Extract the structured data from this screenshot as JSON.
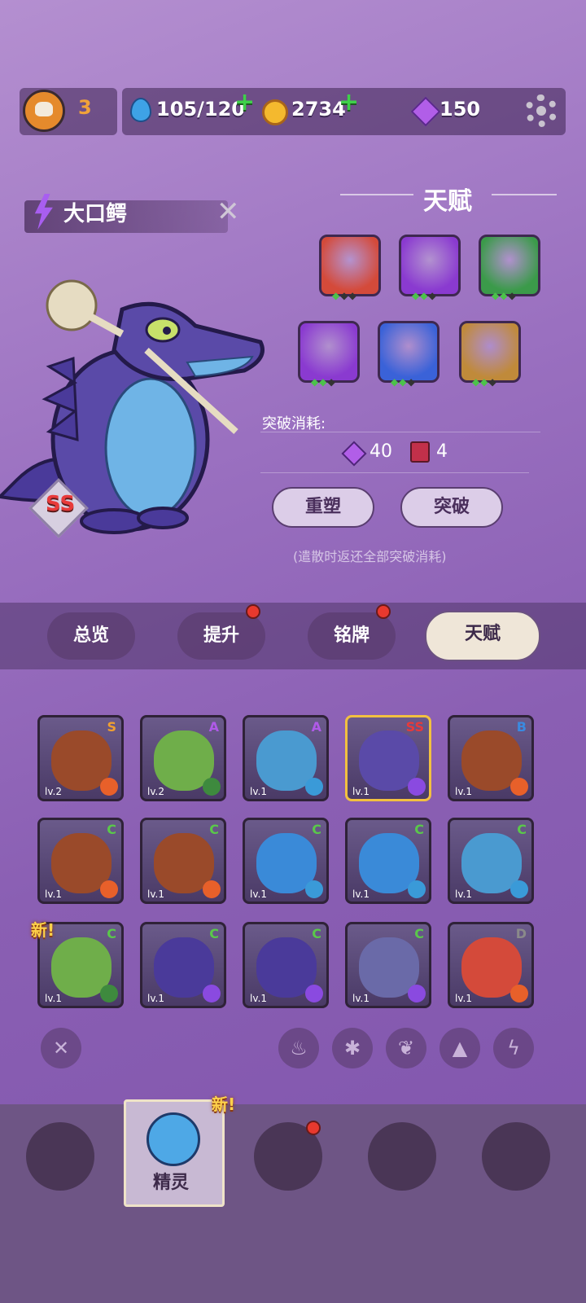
{
  "topbar": {
    "player_level": "3",
    "water": "105/120",
    "coins": "2734",
    "gems": "150",
    "icons": [
      "avatar",
      "water-drop-icon",
      "coin-icon",
      "gem-icon",
      "gear-icon"
    ]
  },
  "monster": {
    "name": "大口鳄",
    "rank": "SS",
    "element": "lightning"
  },
  "talent": {
    "title": "天赋",
    "skills": [
      {
        "color": "#d44a3a",
        "pips": [
          true,
          false,
          false
        ]
      },
      {
        "color": "#8a3ad0",
        "pips": [
          true,
          true,
          false
        ]
      },
      {
        "color": "#3b9a4a",
        "pips": [
          true,
          true,
          false
        ]
      },
      {
        "color": "#8a3ad0",
        "pips": [
          true,
          true,
          false
        ]
      },
      {
        "color": "#3a62d8",
        "pips": [
          true,
          true,
          false
        ]
      },
      {
        "color": "#c08a3a",
        "pips": [
          true,
          true,
          false
        ]
      }
    ],
    "cost_label": "突破消耗:",
    "cost_gems": "40",
    "cost_books": "4",
    "reshape_label": "重塑",
    "breakthrough_label": "突破",
    "note": "(遣散时返还全部突破消耗)"
  },
  "tabs": {
    "overview": "总览",
    "upgrade": "提升",
    "nameplate": "铭牌",
    "talent": "天赋"
  },
  "grid": [
    {
      "lv": "lv.2",
      "rank": "S",
      "rank_color": "#f0a030",
      "body": "#9a4a2a",
      "elem": "#e8602a"
    },
    {
      "lv": "lv.2",
      "rank": "A",
      "rank_color": "#b05ae8",
      "body": "#6fae4a",
      "elem": "#3e8a3e"
    },
    {
      "lv": "lv.1",
      "rank": "A",
      "rank_color": "#b05ae8",
      "body": "#4a9ad0",
      "elem": "#3a9ad8"
    },
    {
      "lv": "lv.1",
      "rank": "SS",
      "rank_color": "#e83a3a",
      "body": "#5a4aa8",
      "elem": "#8a4ae0"
    },
    {
      "lv": "lv.1",
      "rank": "B",
      "rank_color": "#3a8ae0",
      "body": "#9a4a2a",
      "elem": "#e8602a"
    },
    {
      "lv": "lv.1",
      "rank": "C",
      "rank_color": "#5ac84a",
      "body": "#9a4a2a",
      "elem": "#e8602a"
    },
    {
      "lv": "lv.1",
      "rank": "C",
      "rank_color": "#5ac84a",
      "body": "#9a4a2a",
      "elem": "#e8602a"
    },
    {
      "lv": "lv.1",
      "rank": "C",
      "rank_color": "#5ac84a",
      "body": "#3a8ad8",
      "elem": "#3a9ad8"
    },
    {
      "lv": "lv.1",
      "rank": "C",
      "rank_color": "#5ac84a",
      "body": "#3a8ad8",
      "elem": "#3a9ad8"
    },
    {
      "lv": "lv.1",
      "rank": "C",
      "rank_color": "#5ac84a",
      "body": "#4a9ad0",
      "elem": "#3a9ad8"
    },
    {
      "lv": "lv.1",
      "rank": "C",
      "rank_color": "#5ac84a",
      "body": "#6fae4a",
      "elem": "#3e8a3e"
    },
    {
      "lv": "lv.1",
      "rank": "C",
      "rank_color": "#5ac84a",
      "body": "#4a3a9a",
      "elem": "#8a4ae0"
    },
    {
      "lv": "lv.1",
      "rank": "C",
      "rank_color": "#5ac84a",
      "body": "#4a3a9a",
      "elem": "#8a4ae0"
    },
    {
      "lv": "lv.1",
      "rank": "C",
      "rank_color": "#5ac84a",
      "body": "#6a6aa8",
      "elem": "#8a4ae0"
    },
    {
      "lv": "lv.1",
      "rank": "D",
      "rank_color": "#8a8a8a",
      "body": "#d44a3a",
      "elem": "#e8602a"
    }
  ],
  "new_tag": "新!",
  "filters": [
    "close-icon",
    "fire-icon",
    "snowflake-icon",
    "leaf-icon",
    "rock-icon",
    "lightning-icon"
  ],
  "bottom_nav": {
    "spirit_label": "精灵",
    "new_tag": "新!",
    "items": [
      "tv-icon",
      "spirit-icon",
      "mountain-icon",
      "chest-icon",
      "map-pin-icon"
    ]
  }
}
